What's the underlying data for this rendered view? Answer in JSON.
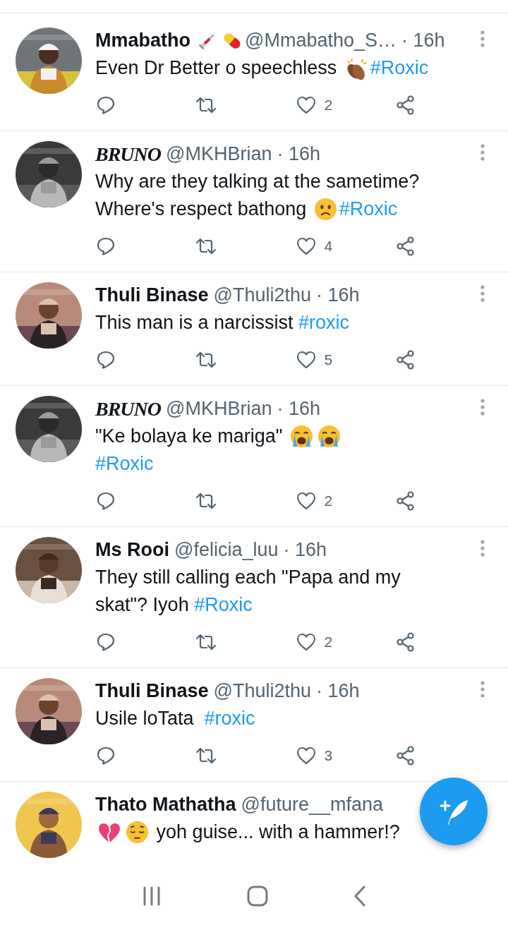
{
  "tweets": [
    {
      "name": "Mmabatho",
      "fancy_name": false,
      "name_emoji": [
        {
          "kind": "syringe"
        },
        {
          "kind": "pill"
        }
      ],
      "handle": "@Mmabatho_S…",
      "time": "· 16h",
      "lines": [
        [
          {
            "kind": "text",
            "text": "Even Dr Better o speechless "
          },
          {
            "kind": "clap"
          },
          {
            "kind": "hashtag",
            "text": "#Roxic"
          }
        ]
      ],
      "likes": "2"
    },
    {
      "name": "BRUNO",
      "fancy_name": true,
      "handle": "@MKHBrian",
      "time": "· 16h",
      "lines": [
        [
          {
            "kind": "text",
            "text": "Why are they talking at the sametime?"
          }
        ],
        [
          {
            "kind": "text",
            "text": "Where's respect bathong "
          },
          {
            "kind": "frown"
          },
          {
            "kind": "hashtag",
            "text": "#Roxic"
          }
        ]
      ],
      "likes": "4"
    },
    {
      "name": "Thuli Binase",
      "fancy_name": false,
      "handle": "@Thuli2thu",
      "time": "· 16h",
      "lines": [
        [
          {
            "kind": "text",
            "text": "This man is a narcissist "
          },
          {
            "kind": "hashtag",
            "text": "#roxic"
          }
        ]
      ],
      "likes": "5"
    },
    {
      "name": "BRUNO",
      "fancy_name": true,
      "handle": "@MKHBrian",
      "time": "· 16h",
      "lines": [
        [
          {
            "kind": "text",
            "text": "\"Ke bolaya ke mariga\" "
          },
          {
            "kind": "crying"
          },
          {
            "kind": "crying"
          }
        ],
        [
          {
            "kind": "hashtag",
            "text": "#Roxic"
          }
        ]
      ],
      "likes": "2"
    },
    {
      "name": "Ms Rooi",
      "fancy_name": false,
      "handle": "@felicia_luu",
      "time": "· 16h",
      "lines": [
        [
          {
            "kind": "text",
            "text": "They still calling each \"Papa and my"
          }
        ],
        [
          {
            "kind": "text",
            "text": "skat\"? Iyoh "
          },
          {
            "kind": "hashtag",
            "text": "#Roxic"
          }
        ]
      ],
      "likes": "2"
    },
    {
      "name": "Thuli Binase",
      "fancy_name": false,
      "handle": "@Thuli2thu",
      "time": "· 16h",
      "lines": [
        [
          {
            "kind": "text",
            "text": "Usile loTata  "
          },
          {
            "kind": "hashtag",
            "text": "#roxic"
          }
        ]
      ],
      "likes": "3"
    },
    {
      "name": "Thato Mathatha",
      "fancy_name": false,
      "handle": "@future__mfana",
      "lines": [
        [
          {
            "kind": "brokenheart"
          },
          {
            "kind": "pensive"
          },
          {
            "kind": "text",
            "text": " yoh guise... with a hammer!?"
          }
        ]
      ]
    }
  ]
}
